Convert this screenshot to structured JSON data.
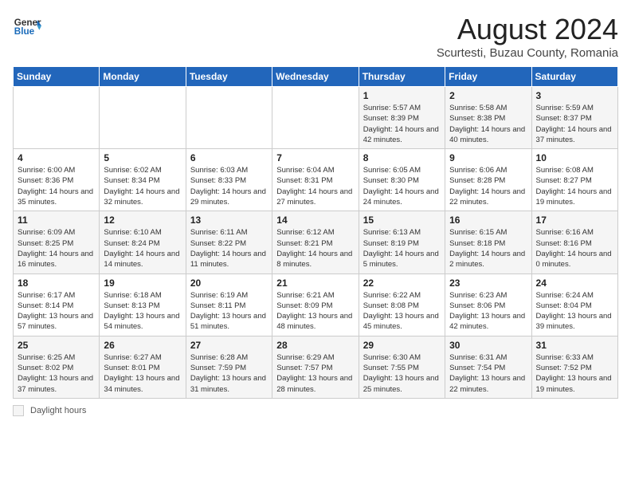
{
  "header": {
    "logo": {
      "general": "General",
      "blue": "Blue"
    },
    "title": "August 2024",
    "subtitle": "Scurtesti, Buzau County, Romania"
  },
  "weekdays": [
    "Sunday",
    "Monday",
    "Tuesday",
    "Wednesday",
    "Thursday",
    "Friday",
    "Saturday"
  ],
  "weeks": [
    [
      {
        "day": "",
        "info": ""
      },
      {
        "day": "",
        "info": ""
      },
      {
        "day": "",
        "info": ""
      },
      {
        "day": "",
        "info": ""
      },
      {
        "day": "1",
        "info": "Sunrise: 5:57 AM\nSunset: 8:39 PM\nDaylight: 14 hours and 42 minutes."
      },
      {
        "day": "2",
        "info": "Sunrise: 5:58 AM\nSunset: 8:38 PM\nDaylight: 14 hours and 40 minutes."
      },
      {
        "day": "3",
        "info": "Sunrise: 5:59 AM\nSunset: 8:37 PM\nDaylight: 14 hours and 37 minutes."
      }
    ],
    [
      {
        "day": "4",
        "info": "Sunrise: 6:00 AM\nSunset: 8:36 PM\nDaylight: 14 hours and 35 minutes."
      },
      {
        "day": "5",
        "info": "Sunrise: 6:02 AM\nSunset: 8:34 PM\nDaylight: 14 hours and 32 minutes."
      },
      {
        "day": "6",
        "info": "Sunrise: 6:03 AM\nSunset: 8:33 PM\nDaylight: 14 hours and 29 minutes."
      },
      {
        "day": "7",
        "info": "Sunrise: 6:04 AM\nSunset: 8:31 PM\nDaylight: 14 hours and 27 minutes."
      },
      {
        "day": "8",
        "info": "Sunrise: 6:05 AM\nSunset: 8:30 PM\nDaylight: 14 hours and 24 minutes."
      },
      {
        "day": "9",
        "info": "Sunrise: 6:06 AM\nSunset: 8:28 PM\nDaylight: 14 hours and 22 minutes."
      },
      {
        "day": "10",
        "info": "Sunrise: 6:08 AM\nSunset: 8:27 PM\nDaylight: 14 hours and 19 minutes."
      }
    ],
    [
      {
        "day": "11",
        "info": "Sunrise: 6:09 AM\nSunset: 8:25 PM\nDaylight: 14 hours and 16 minutes."
      },
      {
        "day": "12",
        "info": "Sunrise: 6:10 AM\nSunset: 8:24 PM\nDaylight: 14 hours and 14 minutes."
      },
      {
        "day": "13",
        "info": "Sunrise: 6:11 AM\nSunset: 8:22 PM\nDaylight: 14 hours and 11 minutes."
      },
      {
        "day": "14",
        "info": "Sunrise: 6:12 AM\nSunset: 8:21 PM\nDaylight: 14 hours and 8 minutes."
      },
      {
        "day": "15",
        "info": "Sunrise: 6:13 AM\nSunset: 8:19 PM\nDaylight: 14 hours and 5 minutes."
      },
      {
        "day": "16",
        "info": "Sunrise: 6:15 AM\nSunset: 8:18 PM\nDaylight: 14 hours and 2 minutes."
      },
      {
        "day": "17",
        "info": "Sunrise: 6:16 AM\nSunset: 8:16 PM\nDaylight: 14 hours and 0 minutes."
      }
    ],
    [
      {
        "day": "18",
        "info": "Sunrise: 6:17 AM\nSunset: 8:14 PM\nDaylight: 13 hours and 57 minutes."
      },
      {
        "day": "19",
        "info": "Sunrise: 6:18 AM\nSunset: 8:13 PM\nDaylight: 13 hours and 54 minutes."
      },
      {
        "day": "20",
        "info": "Sunrise: 6:19 AM\nSunset: 8:11 PM\nDaylight: 13 hours and 51 minutes."
      },
      {
        "day": "21",
        "info": "Sunrise: 6:21 AM\nSunset: 8:09 PM\nDaylight: 13 hours and 48 minutes."
      },
      {
        "day": "22",
        "info": "Sunrise: 6:22 AM\nSunset: 8:08 PM\nDaylight: 13 hours and 45 minutes."
      },
      {
        "day": "23",
        "info": "Sunrise: 6:23 AM\nSunset: 8:06 PM\nDaylight: 13 hours and 42 minutes."
      },
      {
        "day": "24",
        "info": "Sunrise: 6:24 AM\nSunset: 8:04 PM\nDaylight: 13 hours and 39 minutes."
      }
    ],
    [
      {
        "day": "25",
        "info": "Sunrise: 6:25 AM\nSunset: 8:02 PM\nDaylight: 13 hours and 37 minutes."
      },
      {
        "day": "26",
        "info": "Sunrise: 6:27 AM\nSunset: 8:01 PM\nDaylight: 13 hours and 34 minutes."
      },
      {
        "day": "27",
        "info": "Sunrise: 6:28 AM\nSunset: 7:59 PM\nDaylight: 13 hours and 31 minutes."
      },
      {
        "day": "28",
        "info": "Sunrise: 6:29 AM\nSunset: 7:57 PM\nDaylight: 13 hours and 28 minutes."
      },
      {
        "day": "29",
        "info": "Sunrise: 6:30 AM\nSunset: 7:55 PM\nDaylight: 13 hours and 25 minutes."
      },
      {
        "day": "30",
        "info": "Sunrise: 6:31 AM\nSunset: 7:54 PM\nDaylight: 13 hours and 22 minutes."
      },
      {
        "day": "31",
        "info": "Sunrise: 6:33 AM\nSunset: 7:52 PM\nDaylight: 13 hours and 19 minutes."
      }
    ]
  ],
  "footer": {
    "daylight_label": "Daylight hours"
  },
  "colors": {
    "header_bg": "#2266bb",
    "accent": "#1a6bba"
  }
}
